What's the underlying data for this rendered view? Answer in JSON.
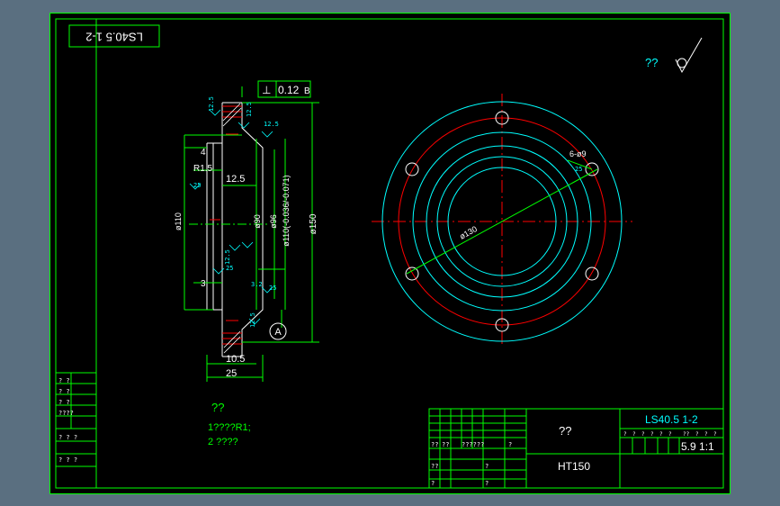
{
  "drawing": {
    "stamp_code": "LS40.5 1-2",
    "roughness_symbol_text": "??",
    "feature_control": {
      "symbol": "⊥",
      "tolerance": "0.12",
      "datum": "B"
    },
    "surface_marks": [
      "12.5",
      "12.5",
      "12.5",
      "25",
      "25",
      "12.5",
      "25",
      "3.2",
      "25",
      "12.5",
      "25"
    ],
    "dims": {
      "d_outer": "ø150",
      "d_fit": "ø110(-0.036/-0.071)",
      "d_bore": "ø96",
      "d_step": "ø90",
      "d_face": "ø110",
      "w_total": "25",
      "w_flange": "10.5",
      "w_step": "12.5",
      "chamfer": "4",
      "radius": "R1.5",
      "small1": "3",
      "small2": "25"
    },
    "datum_label": "A",
    "plan": {
      "pcd": "ø130",
      "holes": "6-ø9",
      "hole_mark": "25"
    },
    "notes": {
      "title": "??",
      "line1": "1????R1;",
      "line2": "2 ????"
    },
    "title_block": {
      "drawing_no": "LS40.5 1-2",
      "part_name": "??",
      "material": "HT150",
      "scale_text": "5.9 1:1",
      "header_cells": [
        "?",
        "?",
        "?",
        "?",
        "?",
        "?",
        "??",
        "?",
        "?",
        "?"
      ],
      "left_cells": [
        "??",
        "??",
        "??????",
        "?",
        "??",
        "?",
        "?",
        "?"
      ]
    },
    "left_strip": [
      "? ?",
      "? ?",
      "? ?",
      "????",
      "? ? ?",
      "? ? ?"
    ],
    "colors": {
      "frame": "#00ff00",
      "cyan": "#00ffff",
      "red": "#ff0000",
      "white": "#ffffff",
      "sheet": "#000000"
    }
  }
}
